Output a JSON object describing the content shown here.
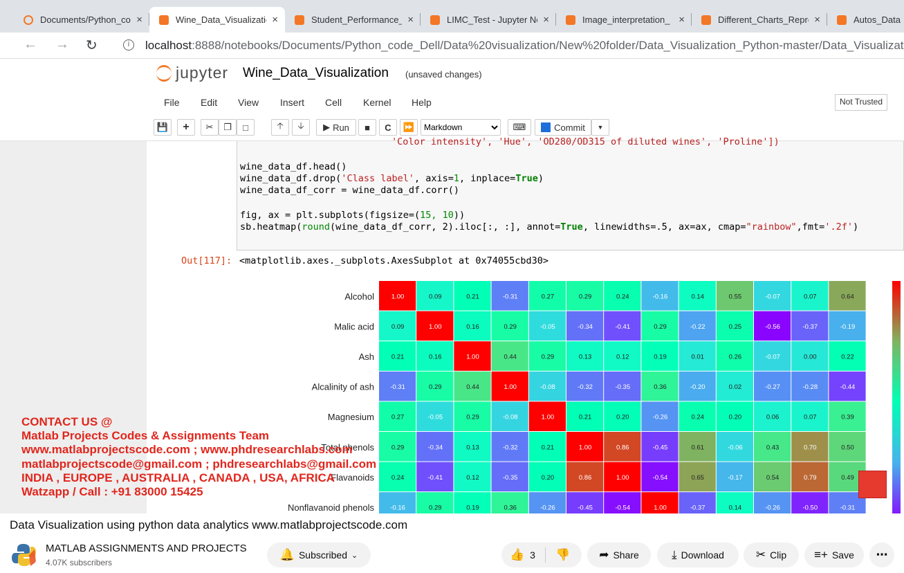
{
  "browser": {
    "tabs": [
      {
        "label": "Documents/Python_co"
      },
      {
        "label": "Wine_Data_Visualizatio"
      },
      {
        "label": "Student_Performance_"
      },
      {
        "label": "LIMC_Test - Jupyter No"
      },
      {
        "label": "Image_interpretation_"
      },
      {
        "label": "Different_Charts_Repre"
      },
      {
        "label": "Autos_Data"
      }
    ],
    "close_glyph": "×",
    "url_host": "localhost",
    "url_path": ":8888/notebooks/Documents/Python_code_Dell/Data%20visualization/New%20folder/Data_Visualization_Python-master/Data_Visualization"
  },
  "jupyter": {
    "logo": "jupyter",
    "notebook_title": "Wine_Data_Visualization",
    "status": "(unsaved changes)",
    "menu": [
      "File",
      "Edit",
      "View",
      "Insert",
      "Cell",
      "Kernel",
      "Help"
    ],
    "trust": "Not Trusted",
    "toolbar": {
      "run": "Run",
      "celltype": "Markdown",
      "commit": "Commit"
    }
  },
  "cell": {
    "line_cut": "'Color intensity', 'Hue', 'OD280/OD315 of diluted wines', 'Proline'])",
    "line_head": "wine_data_df.head()",
    "line_drop_a": "wine_data_df.drop(",
    "line_drop_str": "'Class label'",
    "line_drop_b": ", axis=",
    "line_drop_num": "1",
    "line_drop_c": ", inplace=",
    "line_drop_kw": "True",
    "line_drop_d": ")",
    "line_corr": "wine_data_df_corr = wine_data_df.corr()",
    "line_fig_a": "fig, ax = plt.subplots(figsize=(",
    "line_fig_num": "15, 10",
    "line_fig_b": "))",
    "line_sb_a": "sb.heatmap(",
    "line_sb_round": "round",
    "line_sb_b": "(wine_data_df_corr, 2).iloc[:, :], annot=",
    "line_sb_kw": "True",
    "line_sb_c": ", linewidths=.5, ax=ax, cmap=",
    "line_sb_str": "\"rainbow\"",
    "line_sb_d": ",fmt=",
    "line_sb_fmt": "'.2f'",
    "line_sb_e": ")"
  },
  "output": {
    "prompt": "Out[117]:",
    "text": "<matplotlib.axes._subplots.AxesSubplot at 0x74055cbd30>"
  },
  "chart_data": {
    "type": "heatmap",
    "cmap": "rainbow",
    "rows": [
      "Alcohol",
      "Malic acid",
      "Ash",
      "Alcalinity of ash",
      "Magnesium",
      "Total phenols",
      "Flavanoids",
      "Nonflavanoid phenols"
    ],
    "values": [
      [
        1.0,
        0.09,
        0.21,
        -0.31,
        0.27,
        0.29,
        0.24,
        -0.16,
        0.14,
        0.55,
        -0.07,
        0.07,
        0.64
      ],
      [
        0.09,
        1.0,
        0.16,
        0.29,
        -0.05,
        -0.34,
        -0.41,
        0.29,
        -0.22,
        0.25,
        -0.56,
        -0.37,
        -0.19
      ],
      [
        0.21,
        0.16,
        1.0,
        0.44,
        0.29,
        0.13,
        0.12,
        0.19,
        0.01,
        0.26,
        -0.07,
        0.0,
        0.22
      ],
      [
        -0.31,
        0.29,
        0.44,
        1.0,
        -0.08,
        -0.32,
        -0.35,
        0.36,
        -0.2,
        0.02,
        -0.27,
        -0.28,
        -0.44
      ],
      [
        0.27,
        -0.05,
        0.29,
        -0.08,
        1.0,
        0.21,
        0.2,
        -0.26,
        0.24,
        0.2,
        0.06,
        0.07,
        0.39
      ],
      [
        0.29,
        -0.34,
        0.13,
        -0.32,
        0.21,
        1.0,
        0.86,
        -0.45,
        0.61,
        -0.06,
        0.43,
        0.7,
        0.5
      ],
      [
        0.24,
        -0.41,
        0.12,
        -0.35,
        0.2,
        0.86,
        1.0,
        -0.54,
        0.65,
        -0.17,
        0.54,
        0.79,
        0.49
      ],
      [
        -0.16,
        0.29,
        0.19,
        0.36,
        -0.26,
        -0.45,
        -0.54,
        1.0,
        -0.37,
        0.14,
        -0.26,
        -0.5,
        -0.31
      ]
    ],
    "vmin": -0.57,
    "vmax": 1.0
  },
  "watermark": {
    "lines": [
      "CONTACT US @",
      "Matlab Projects Codes & Assignments Team",
      "www.matlabprojectscode.com ; www.phdresearchlabs.com",
      "matlabprojectscode@gmail.com ; phdresearchlabs@gmail.com",
      "INDIA , EUROPE , AUSTRALIA , CANADA , USA, AFRICA",
      "Watzapp / Call : +91 83000 15425"
    ]
  },
  "youtube": {
    "title": "Data Visualization using python data analytics www.matlabprojectscode.com",
    "channel": "MATLAB ASSIGNMENTS AND PROJECTS",
    "subscribers": "4.07K subscribers",
    "subscribed_label": "Subscribed",
    "likes": "3",
    "share": "Share",
    "download": "Download",
    "clip": "Clip",
    "save": "Save"
  }
}
